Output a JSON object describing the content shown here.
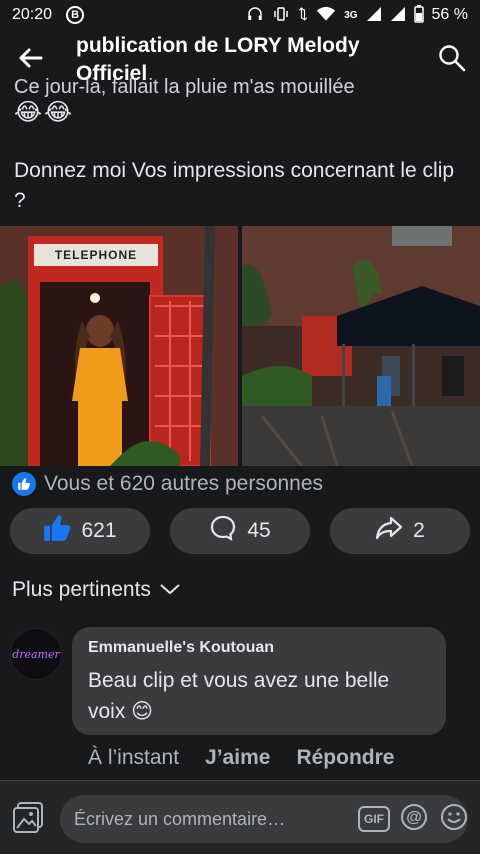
{
  "status_bar": {
    "time": "20:20",
    "b_badge": "B",
    "network": "3G",
    "battery": "56 %"
  },
  "header": {
    "title": "publication de LORY Melody Officiel",
    "back_icon": "arrow-left-icon",
    "search_icon": "search-icon"
  },
  "post": {
    "cut_text": "Ce jour-là, fallait la pluie m'as mouillée",
    "emojis": [
      "😂",
      "😂"
    ],
    "text": "Donnez moi Vos impressions concernant le clip ?",
    "photo1_sign": "TELEPHONE"
  },
  "reactions": {
    "summary": "Vous et 620 autres personnes"
  },
  "actions": {
    "like_count": "621",
    "comment_count": "45",
    "share_count": "2"
  },
  "sort": {
    "label": "Plus pertinents"
  },
  "comment": {
    "avatar_text": "dreamer",
    "author": "Emmanuelle's Koutouan",
    "text": "Beau clip et vous avez une belle voix 😊",
    "time": "À l’instant",
    "like_label": "J’aime",
    "reply_label": "Répondre"
  },
  "composer": {
    "placeholder": "Écrivez un commentaire…",
    "gif_label": "GIF"
  },
  "colors": {
    "background": "#18191a",
    "surface": "#3a3b3c",
    "accent": "#1877f2",
    "text_secondary": "#b0b3b8"
  }
}
